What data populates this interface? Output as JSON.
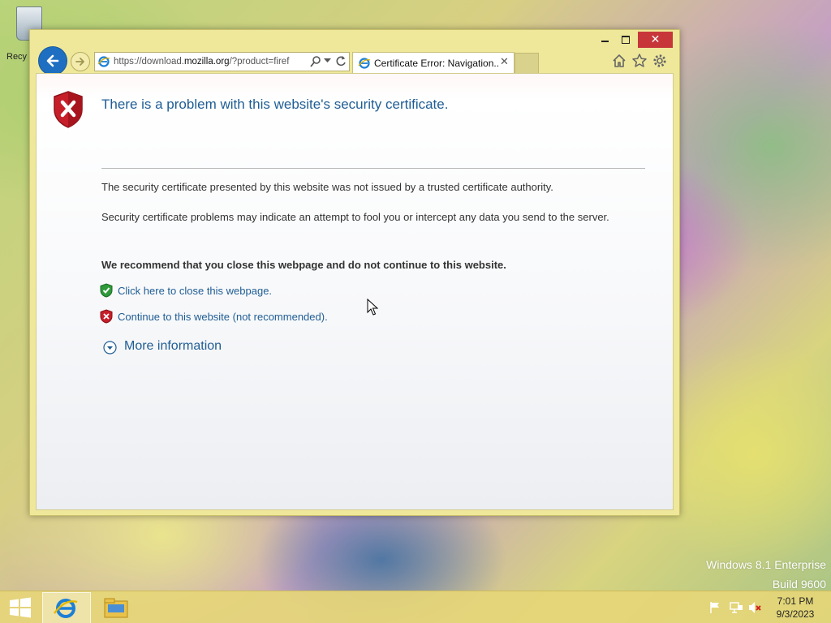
{
  "desktop": {
    "recycle_bin_label": "Recy",
    "watermark": {
      "line1": "Windows 8.1 Enterprise",
      "line2": "Build 9600"
    }
  },
  "browser": {
    "window_controls": {
      "minimize_icon": "minimize-icon",
      "maximize_icon": "maximize-icon",
      "close_label": "✕"
    },
    "address": {
      "prefix": "https://download.",
      "domain": "mozilla.org",
      "suffix": "/?product=firef"
    },
    "tab": {
      "title": "Certificate Error: Navigation...",
      "close_label": "✕"
    },
    "toolbar_icons": [
      "home-icon",
      "favorites-star-icon",
      "settings-gear-icon"
    ]
  },
  "page": {
    "title": "There is a problem with this website's security certificate.",
    "paragraph1": "The security certificate presented by this website was not issued by a trusted certificate authority.",
    "paragraph2": "Security certificate problems may indicate an attempt to fool you or intercept any data you send to the server.",
    "recommendation": "We recommend that you close this webpage and do not continue to this website.",
    "close_link": "Click here to close this webpage.",
    "continue_link": "Continue to this website (not recommended).",
    "more_info": "More information"
  },
  "taskbar": {
    "clock_time": "7:01 PM",
    "clock_date": "9/3/2023"
  },
  "colors": {
    "link": "#1f5d94",
    "close_button": "#c7373a",
    "window_frame": "#efe89a",
    "back_button": "#1e6fc1"
  }
}
